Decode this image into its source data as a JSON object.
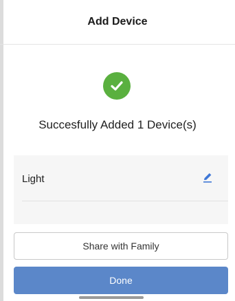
{
  "header": {
    "title": "Add Device"
  },
  "success": {
    "icon": "check-circle-icon",
    "message": "Succesfully Added 1 Device(s)"
  },
  "devices": [
    {
      "name": "Light",
      "edit_icon": "pencil-edit-icon"
    }
  ],
  "actions": {
    "share_label": "Share with Family",
    "done_label": "Done"
  },
  "colors": {
    "success_green": "#5ab03f",
    "accent_blue": "#5b87c9",
    "edit_icon_blue": "#3f77d6"
  }
}
